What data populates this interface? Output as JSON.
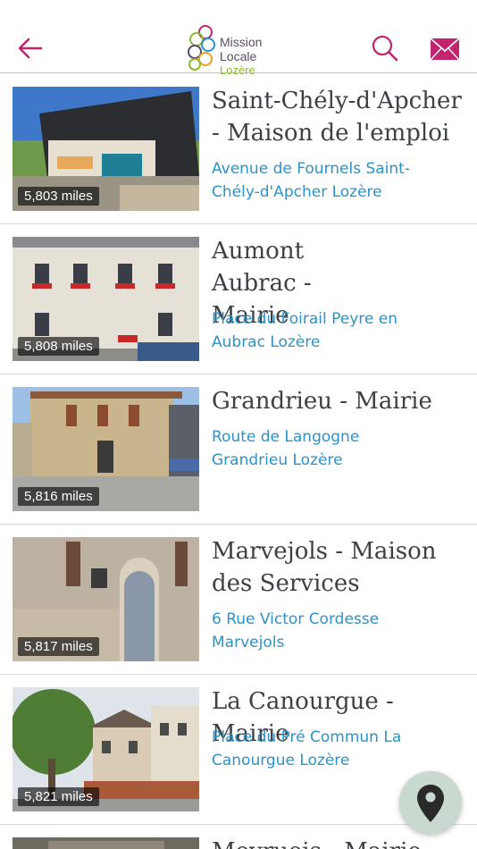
{
  "header": {
    "logo_line1": "Mission Locale",
    "logo_line2": "Lozère"
  },
  "colors": {
    "accent": "#c0256d",
    "link": "#2b93c9",
    "title": "#3c4148",
    "fab": "#c9d9cf"
  },
  "icons": {
    "back": "arrow-left-icon",
    "search": "search-icon",
    "mail": "mail-icon",
    "map": "map-pin-icon"
  },
  "locations": [
    {
      "title": "Saint-Chély-d'Apcher - Maison de l'emploi",
      "address": "Avenue de Fournels Saint-Chély-d'Apcher Lozère",
      "distance": "5,803 miles"
    },
    {
      "title": "Aumont Aubrac - Mairie",
      "address": "Place du Foirail Peyre en Aubrac Lozère",
      "distance": "5,808 miles"
    },
    {
      "title": "Grandrieu - Mairie",
      "address": "Route de Langogne Grandrieu Lozère",
      "distance": "5,816 miles"
    },
    {
      "title": "Marvejols - Maison des Services",
      "address": "6 Rue Victor Cordesse Marvejols",
      "distance": "5,817 miles"
    },
    {
      "title": "La Canourgue - Mairie",
      "address": "Place du Pré Commun La Canourgue Lozère",
      "distance": "5,821 miles"
    },
    {
      "title": "Meyrueis - Mairie",
      "address": "",
      "distance": ""
    }
  ]
}
